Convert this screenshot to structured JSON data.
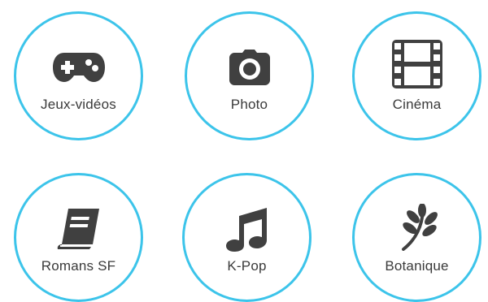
{
  "hobbies": [
    {
      "label": "Jeux-vidéos",
      "icon": "gamepad-icon"
    },
    {
      "label": "Photo",
      "icon": "camera-icon"
    },
    {
      "label": "Cinéma",
      "icon": "film-icon"
    },
    {
      "label": "Romans SF",
      "icon": "book-icon"
    },
    {
      "label": "K-Pop",
      "icon": "music-note-icon"
    },
    {
      "label": "Botanique",
      "icon": "leaf-branch-icon"
    }
  ],
  "colors": {
    "ring": "#3cc4ea",
    "icon": "#404040",
    "text": "#3a3a3a"
  }
}
